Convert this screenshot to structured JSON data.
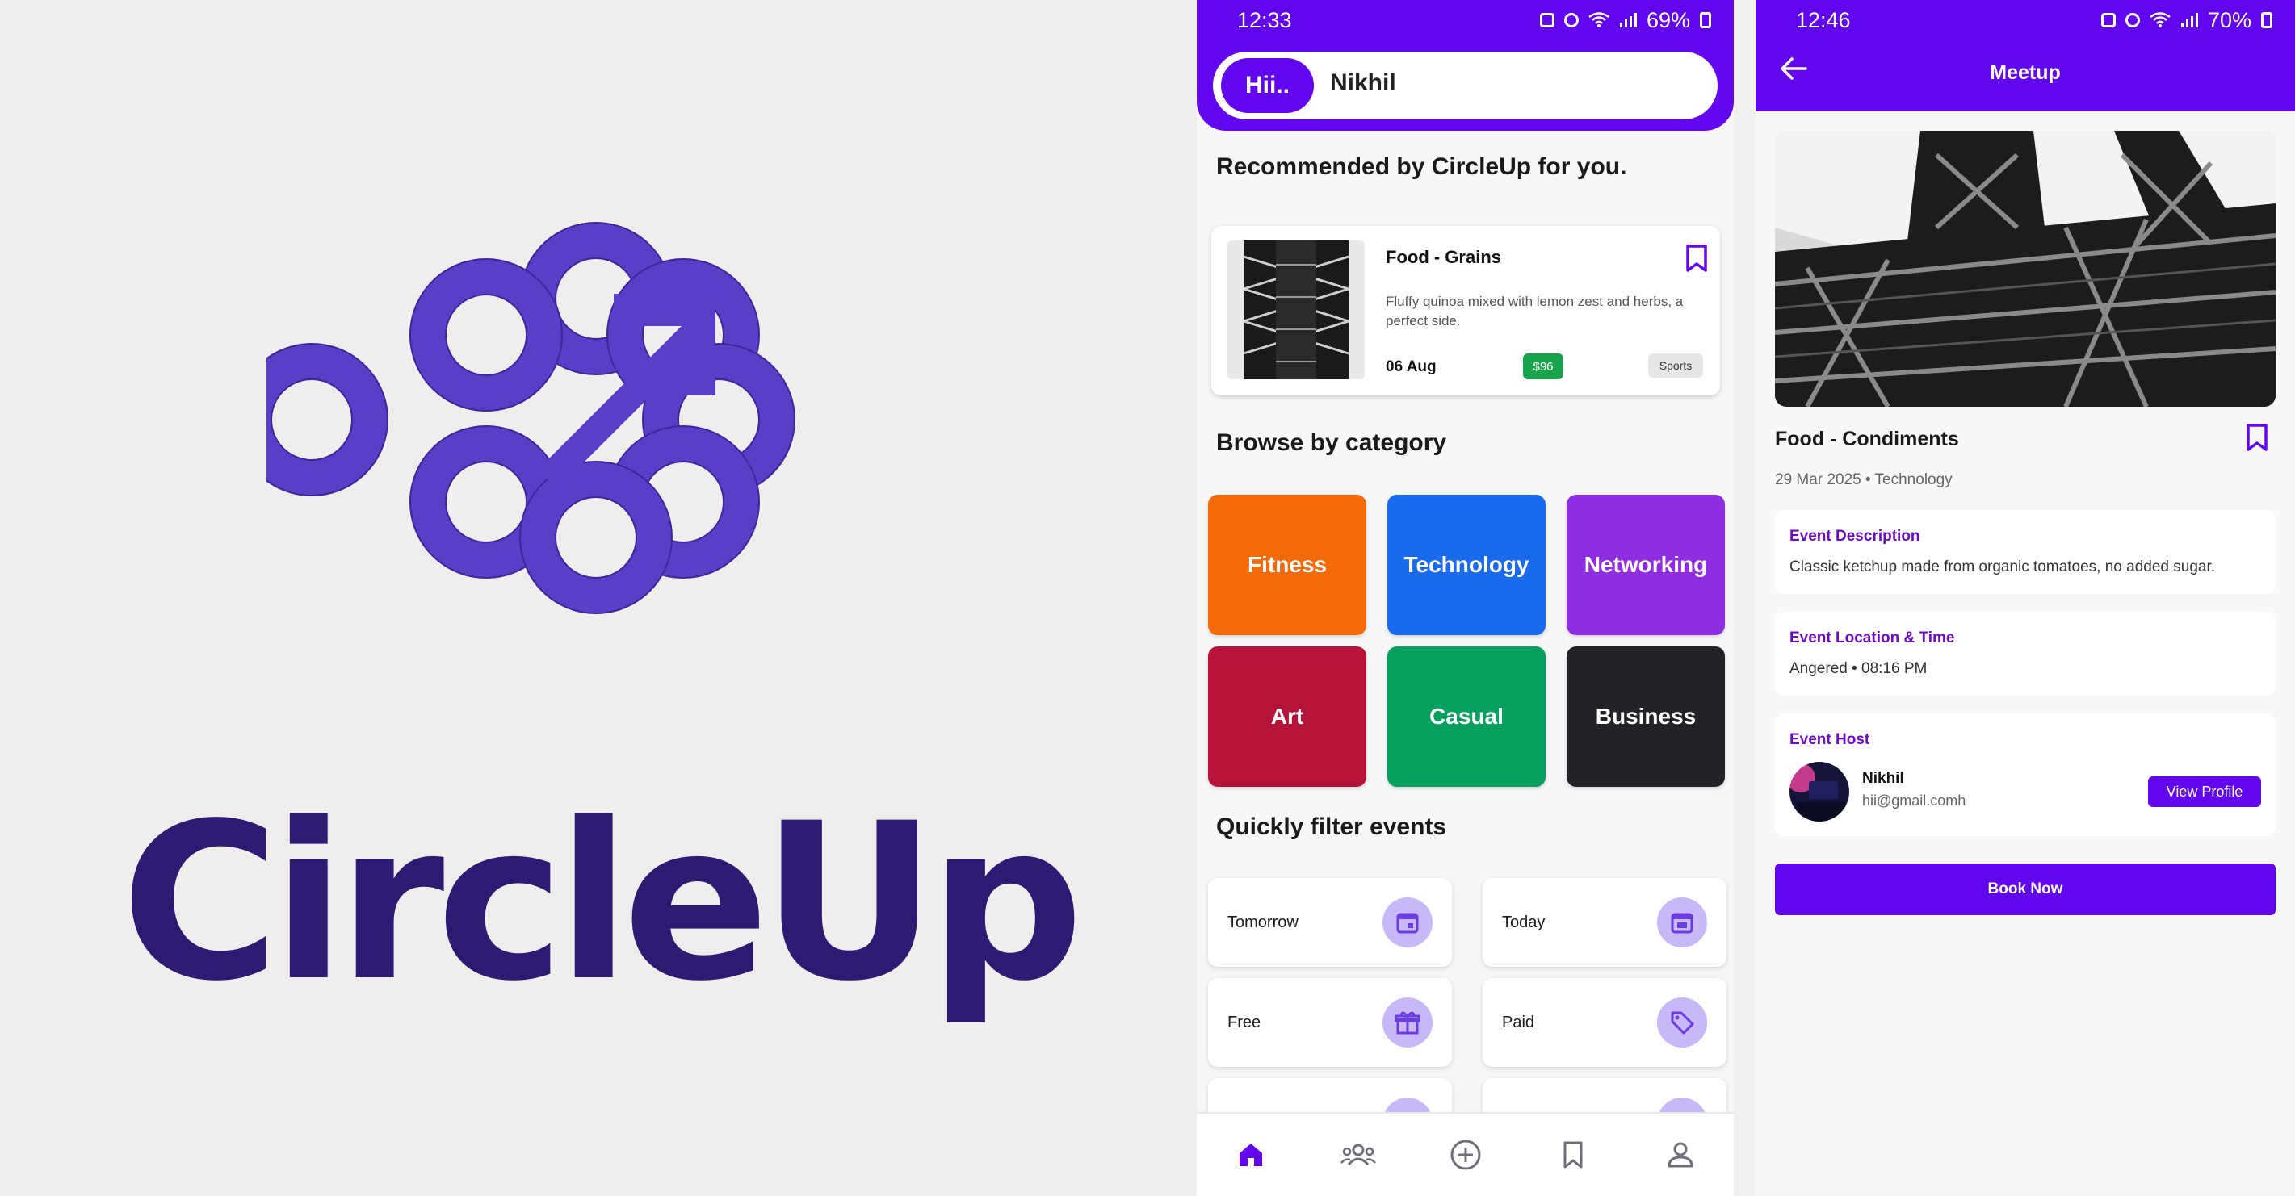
{
  "logo": {
    "wordmark": "CircleUp",
    "brand_color": "#5a3ec8",
    "wordmark_color": "#2c1a73",
    "icon_name": "circle-up-arrow-logo"
  },
  "home": {
    "status": {
      "time": "12:33",
      "battery": "69%"
    },
    "greeting": {
      "chip": "Hii..",
      "name": "Nikhil"
    },
    "recommended_title": "Recommended by CircleUp for you.",
    "recommended_card": {
      "title": "Food - Grains",
      "description": "Fluffy quinoa mixed with lemon zest and herbs, a perfect side.",
      "date": "06 Aug",
      "price": "$96",
      "tag": "Sports"
    },
    "browse_title": "Browse by category",
    "categories": [
      {
        "label": "Fitness",
        "color": "#f46a0a"
      },
      {
        "label": "Technology",
        "color": "#1a6aee"
      },
      {
        "label": "Networking",
        "color": "#8e2de2"
      },
      {
        "label": "Art",
        "color": "#b51338"
      },
      {
        "label": "Casual",
        "color": "#06a05e"
      },
      {
        "label": "Business",
        "color": "#222326"
      }
    ],
    "filter_title": "Quickly filter events",
    "filters": [
      {
        "label": "Tomorrow",
        "icon": "calendar-icon"
      },
      {
        "label": "Today",
        "icon": "calendar-icon"
      },
      {
        "label": "Free",
        "icon": "gift-icon"
      },
      {
        "label": "Paid",
        "icon": "tag-icon"
      }
    ],
    "nav": [
      "home-icon",
      "groups-icon",
      "add-circle-icon",
      "bookmark-icon",
      "profile-icon"
    ]
  },
  "detail": {
    "status": {
      "time": "12:46",
      "battery": "70%"
    },
    "title": "Meetup",
    "event_name": "Food - Condiments",
    "meta": "29 Mar 2025 • Technology",
    "description_label": "Event Description",
    "description": "Classic ketchup made from organic tomatoes, no added sugar.",
    "location_label": "Event Location & Time",
    "location": "Angered • 08:16 PM",
    "host_label": "Event Host",
    "host_name": "Nikhil",
    "host_email": "hii@gmail.comh",
    "view_profile": "View Profile",
    "book_now": "Book Now"
  },
  "colors": {
    "primary": "#6206ee",
    "filter_icon_bg": "#c9b8f8"
  }
}
